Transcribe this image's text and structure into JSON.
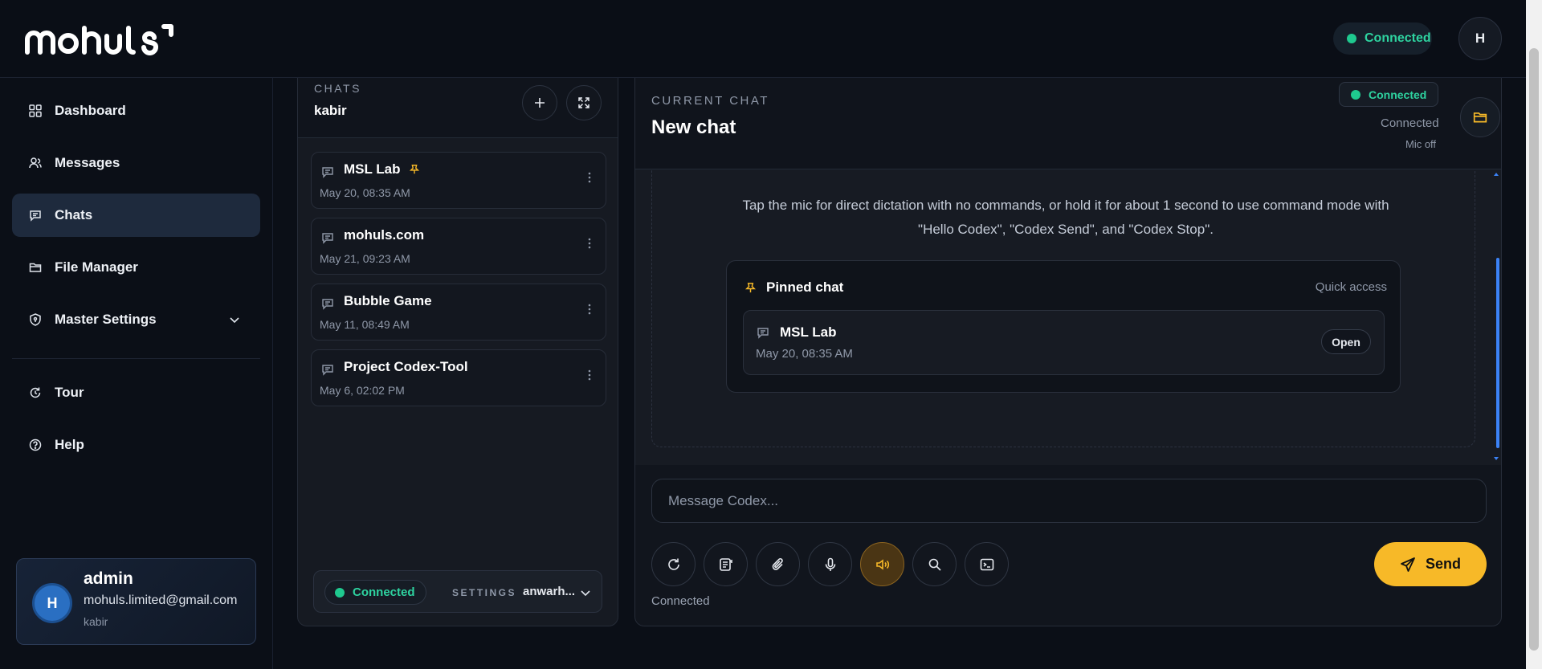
{
  "brand": {
    "logo_text": "mohuls"
  },
  "topbar": {
    "status": "Connected",
    "avatar_initial": "H"
  },
  "sidebar": {
    "items": [
      {
        "label": "Dashboard",
        "icon": "grid-icon"
      },
      {
        "label": "Messages",
        "icon": "users-icon"
      },
      {
        "label": "Chats",
        "icon": "chat-icon",
        "active": true
      },
      {
        "label": "File Manager",
        "icon": "folder-icon"
      },
      {
        "label": "Master Settings",
        "icon": "shield-icon"
      },
      {
        "label": "Tour",
        "icon": "refresh-icon"
      },
      {
        "label": "Help",
        "icon": "help-icon"
      }
    ],
    "user": {
      "initial": "H",
      "name": "admin",
      "email": "mohuls.limited@gmail.com",
      "org": "kabir"
    }
  },
  "chats_panel": {
    "label": "CHATS",
    "user": "kabir",
    "items": [
      {
        "title": "MSL Lab",
        "date": "May 20, 08:35 AM",
        "pinned": true
      },
      {
        "title": "mohuls.com",
        "date": "May 21, 09:23 AM"
      },
      {
        "title": "Bubble Game",
        "date": "May 11, 08:49 AM"
      },
      {
        "title": "Project Codex-Tool",
        "date": "May 6, 02:02 PM"
      }
    ],
    "footer": {
      "status": "Connected",
      "settings_label": "SETTINGS",
      "host": "anwarh..."
    }
  },
  "chat": {
    "label": "CURRENT CHAT",
    "title": "New chat",
    "status_badge": "Connected",
    "connection_text": "Connected",
    "mic_status": "Mic off",
    "help_text": "Tap the mic for direct dictation with no commands, or hold it for about 1 second to use command mode with \"Hello Codex\", \"Codex Send\", and \"Codex Stop\".",
    "pinned": {
      "title": "Pinned chat",
      "quick": "Quick access",
      "item_title": "MSL Lab",
      "item_date": "May 20, 08:35 AM",
      "open_label": "Open"
    },
    "input_placeholder": "Message Codex...",
    "tools": [
      "refresh-icon",
      "notes-icon",
      "paperclip-icon",
      "mic-icon",
      "speaker-icon",
      "search-icon",
      "terminal-icon"
    ],
    "send_label": "Send",
    "footer_status": "Connected"
  },
  "colors": {
    "accent": "#f7b928",
    "connected": "#1fc98f",
    "active_nav": "#1e2a3d"
  }
}
